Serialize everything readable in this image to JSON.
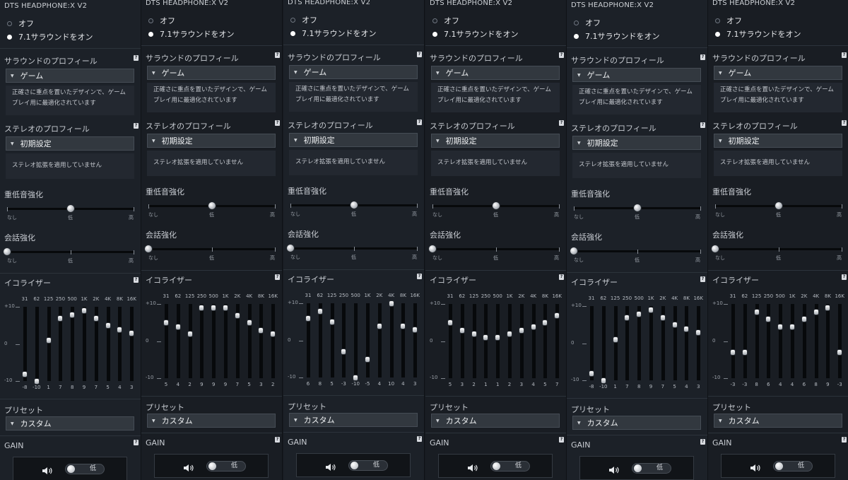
{
  "app_title": "DTS HEADPHONE:X V2",
  "help_glyph": "?",
  "radio": {
    "off_label": "オフ",
    "surround_label": "7.1サラウンドをオン",
    "selected": "surround"
  },
  "surround_profile": {
    "heading": "サラウンドのプロフィール",
    "value": "ゲーム",
    "description_line1": "正確さに重点を置いたデザインで、ゲーム",
    "description_line2": "プレイ用に最適化されています"
  },
  "stereo_profile": {
    "heading": "ステレオのプロフィール",
    "value": "初期設定",
    "description": "ステレオ拡張を適用していません"
  },
  "bass": {
    "heading": "重低音強化",
    "labels": [
      "なし",
      "低",
      "高"
    ],
    "level": "低"
  },
  "dialog": {
    "heading": "会話強化",
    "labels": [
      "なし",
      "低",
      "高"
    ],
    "level": "なし"
  },
  "equalizer": {
    "heading": "イコライザー",
    "bands": [
      "31",
      "62",
      "125",
      "250",
      "500",
      "1K",
      "2K",
      "4K",
      "8K",
      "16K"
    ],
    "axis_labels": [
      "+10",
      "0",
      "-10"
    ],
    "range": [
      -10,
      10
    ]
  },
  "preset": {
    "heading": "プリセット",
    "value": "カスタム"
  },
  "gain": {
    "heading": "GAIN",
    "level_label": "低",
    "speaker_icon": "speaker-icon"
  },
  "panels": [
    {
      "eq_values": [
        -8,
        -10,
        1,
        7,
        8,
        9,
        7,
        5,
        4,
        3
      ]
    },
    {
      "eq_values": [
        5,
        4,
        2,
        9,
        9,
        9,
        7,
        5,
        3,
        2
      ]
    },
    {
      "eq_values": [
        6,
        8,
        5,
        -3,
        -10,
        -5,
        4,
        10,
        4,
        3
      ]
    },
    {
      "eq_values": [
        5,
        3,
        2,
        1,
        1,
        2,
        3,
        4,
        5,
        7
      ]
    },
    {
      "eq_values": [
        -8,
        -10,
        1,
        7,
        8,
        9,
        7,
        5,
        4,
        3
      ]
    },
    {
      "eq_values": [
        -3,
        -3,
        8,
        6,
        4,
        4,
        6,
        8,
        9,
        -3
      ]
    }
  ]
}
